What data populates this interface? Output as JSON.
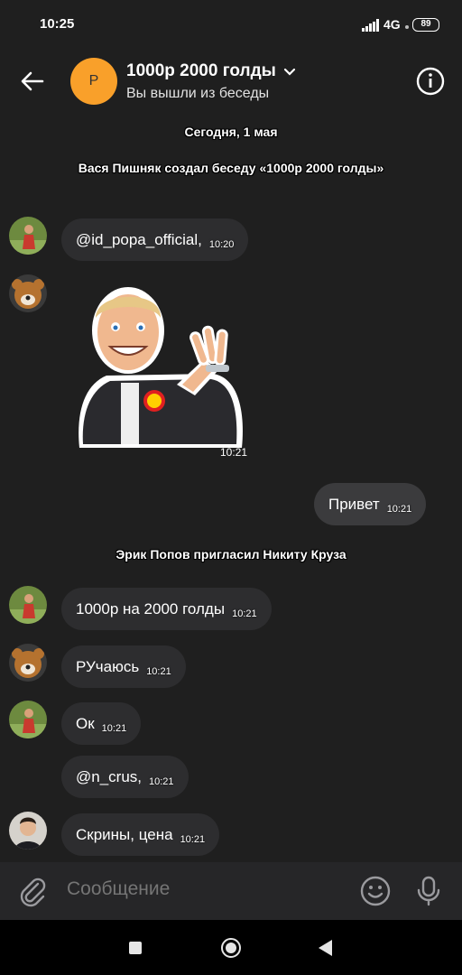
{
  "status": {
    "time": "10:25",
    "network": "4G",
    "battery": "89"
  },
  "header": {
    "avatar_letter": "P",
    "title": "1000р 2000 голды",
    "subtitle": "Вы вышли из беседы"
  },
  "system": {
    "date": "Сегодня, 1 мая",
    "created": "Вася Пишняк создал беседу «1000р 2000 голды»",
    "invited": "Эрик Попов пригласил Никиту Круза"
  },
  "messages": [
    {
      "text": "@id_popa_official,",
      "time": "10:20"
    },
    {
      "sticker_time": "10:21"
    },
    {
      "text": "Привет",
      "time": "10:21",
      "outgoing": true
    },
    {
      "text": "1000р на 2000 голды",
      "time": "10:21"
    },
    {
      "text": "РУчаюсь",
      "time": "10:21"
    },
    {
      "text": "Ок",
      "time": "10:21"
    },
    {
      "text": "@n_crus,",
      "time": "10:21"
    },
    {
      "text": "Скрины, цена",
      "time": "10:21"
    }
  ],
  "composer": {
    "placeholder": "Сообщение"
  },
  "colors": {
    "accent": "#f9a02a",
    "background": "#1f1f1f",
    "bubble": "#2d2d2f"
  }
}
